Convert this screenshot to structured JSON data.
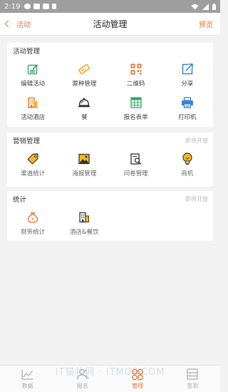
{
  "status": {
    "time": "2:19"
  },
  "nav": {
    "back_label": "活动",
    "title": "活动管理",
    "right_label": "预览"
  },
  "sections": {
    "activity": {
      "title": "活动管理",
      "items": [
        {
          "label": "编辑活动",
          "icon": "edit-icon"
        },
        {
          "label": "票种管理",
          "icon": "ticket-icon"
        },
        {
          "label": "二维码",
          "icon": "qrcode-icon"
        },
        {
          "label": "分享",
          "icon": "share-icon"
        },
        {
          "label": "活动酒店",
          "icon": "hotel-icon"
        },
        {
          "label": "餐",
          "icon": "dining-bell-icon"
        },
        {
          "label": "报名表单",
          "icon": "form-table-icon"
        },
        {
          "label": "打印机",
          "icon": "printer-icon"
        }
      ]
    },
    "marketing": {
      "title": "营销管理",
      "badge": "即将开放",
      "items": [
        {
          "label": "渠道统计",
          "icon": "tag-icon"
        },
        {
          "label": "海报管理",
          "icon": "poster-icon"
        },
        {
          "label": "问卷管理",
          "icon": "survey-icon"
        },
        {
          "label": "商机",
          "icon": "lightbulb-icon"
        }
      ]
    },
    "stats": {
      "title": "统计",
      "badge": "即将开放",
      "items": [
        {
          "label": "财务统计",
          "icon": "money-bag-icon"
        },
        {
          "label": "酒店&餐饮",
          "icon": "hotel-dining-icon"
        }
      ]
    }
  },
  "tabs": [
    {
      "label": "数据",
      "icon": "chart-icon"
    },
    {
      "label": "报名",
      "icon": "users-icon"
    },
    {
      "label": "管理",
      "icon": "manage-icon"
    },
    {
      "label": "签到",
      "icon": "checkin-icon"
    }
  ],
  "watermark": "IT猫扑网 · ITMOP.COM",
  "colors": {
    "accent": "#e8742f",
    "green": "#3aa564",
    "yellow": "#f5b820",
    "blue": "#3b82d6"
  }
}
